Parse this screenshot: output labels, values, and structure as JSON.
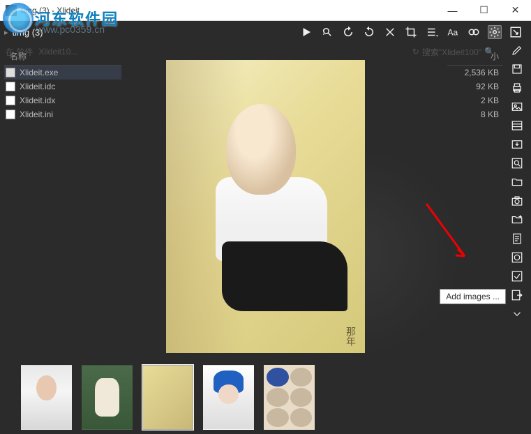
{
  "window": {
    "title": "timg (3) - Xlideit"
  },
  "watermark": {
    "text": "河东软件园",
    "url": "www.pc0359.cn"
  },
  "topbar": {
    "image_name": "timg (3)"
  },
  "explorer": {
    "breadcrumb_prefix": "在 软件",
    "breadcrumb_item": "Xlideit10...",
    "search_refresh": "↻",
    "search_placeholder": "搜索\"Xlideit100\""
  },
  "file_panel": {
    "header": "名称",
    "files": [
      {
        "name": "Xlideit.exe",
        "type": "exe"
      },
      {
        "name": "Xlideit.idc",
        "type": "doc"
      },
      {
        "name": "Xlideit.idx",
        "type": "doc"
      },
      {
        "name": "Xlideit.ini",
        "type": "doc"
      }
    ]
  },
  "meta_panel": {
    "header": "小",
    "sizes": [
      "2,536 KB",
      "92 KB",
      "2 KB",
      "8 KB"
    ]
  },
  "main_image": {
    "caption": "那年"
  },
  "tooltip": {
    "text": "Add images ..."
  },
  "thumbs": {
    "selected_index": 2,
    "count": 5
  }
}
